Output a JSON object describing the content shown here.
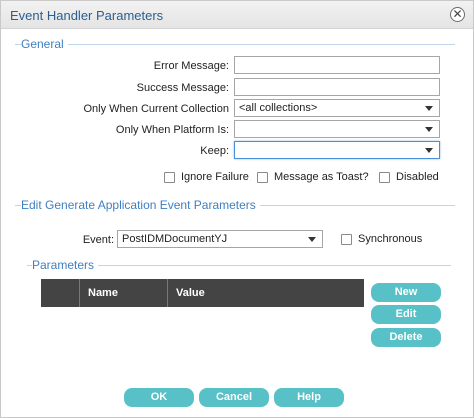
{
  "window": {
    "title": "Event Handler Parameters",
    "close_icon": "close-icon"
  },
  "general": {
    "section_title": "General",
    "error_message": {
      "label": "Error Message:",
      "value": ""
    },
    "success_message": {
      "label": "Success Message:",
      "value": ""
    },
    "collection": {
      "label": "Only When Current Collection",
      "selected": "<all collections>"
    },
    "platform": {
      "label": "Only When Platform Is:",
      "selected": ""
    },
    "keep": {
      "label": "Keep:",
      "selected": ""
    },
    "ignore_failure": {
      "label": "Ignore Failure",
      "checked": false
    },
    "message_toast": {
      "label": "Message as Toast?",
      "checked": false
    },
    "disabled": {
      "label": "Disabled",
      "checked": false
    }
  },
  "event_params": {
    "section_title": "Edit Generate Application Event Parameters",
    "event": {
      "label": "Event:",
      "selected": "PostIDMDocumentYJ"
    },
    "synchronous": {
      "label": "Synchronous",
      "checked": false
    }
  },
  "parameters": {
    "section_title": "Parameters",
    "columns": [
      "",
      "Name",
      "Value"
    ],
    "rows": [],
    "new_label": "New",
    "edit_label": "Edit",
    "delete_label": "Delete"
  },
  "footer": {
    "ok_label": "OK",
    "cancel_label": "Cancel",
    "help_label": "Help"
  },
  "colors": {
    "accent": "#58c0c7",
    "section": "#3f7fbf",
    "header": "#444444"
  }
}
